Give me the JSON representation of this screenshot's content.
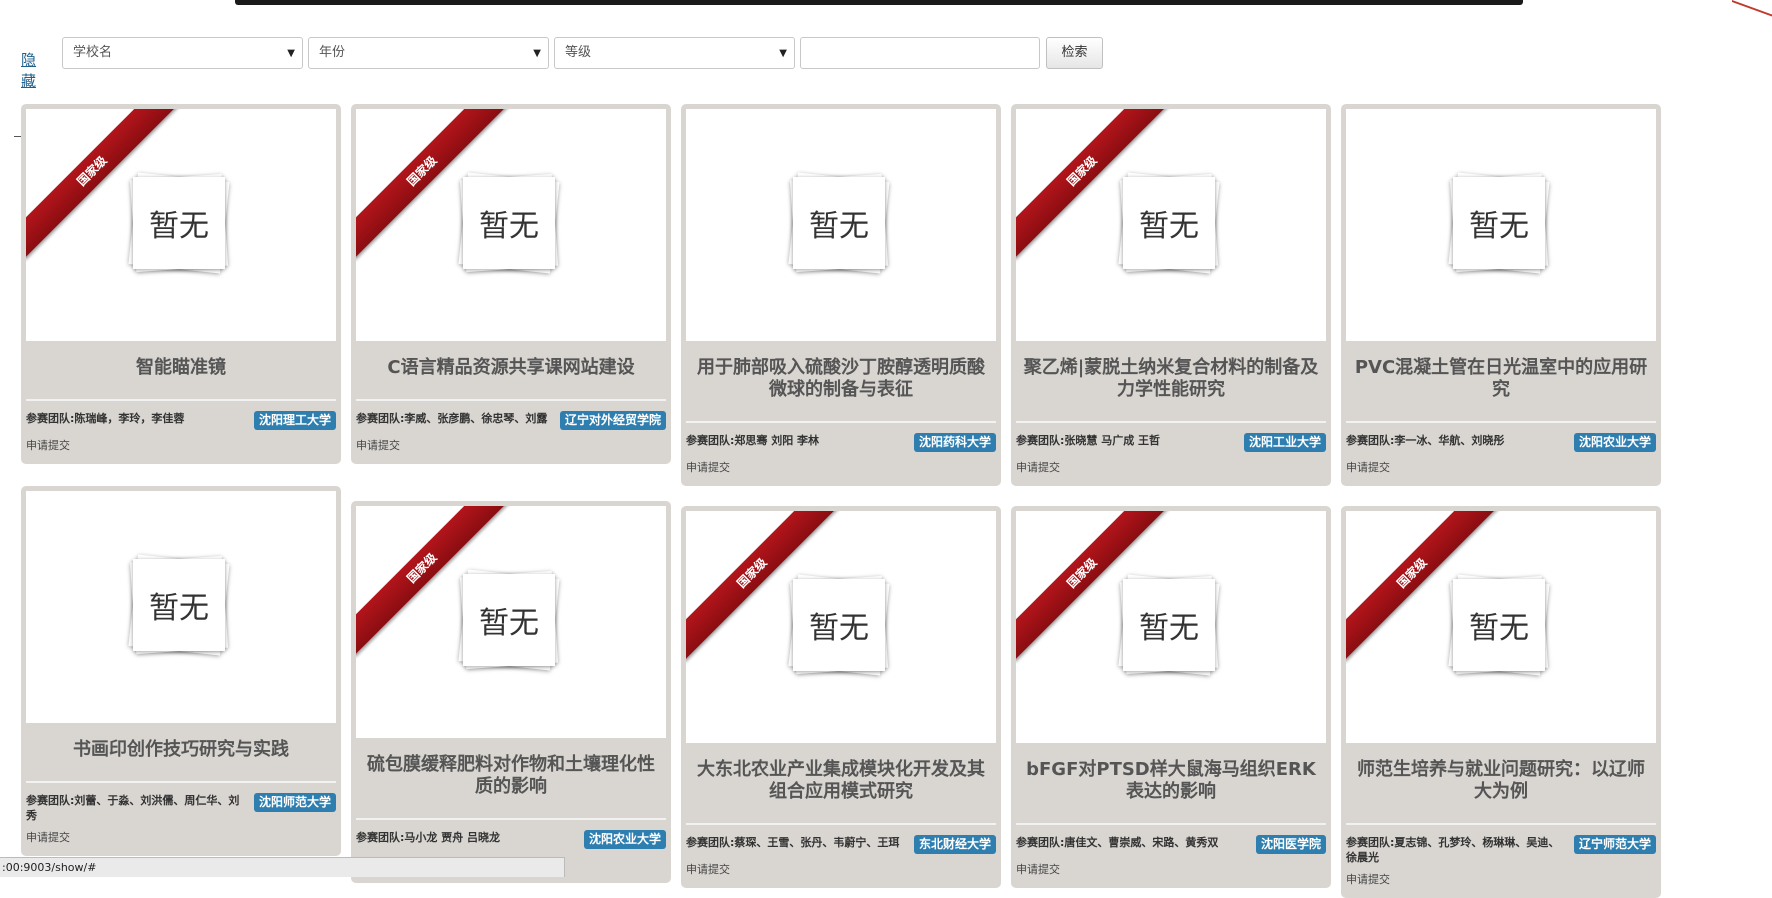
{
  "filters": {
    "hide_link": "隐藏",
    "school_select": "学校名",
    "year_select": "年份",
    "level_select": "等级",
    "search_input_value": "",
    "search_button": "检索"
  },
  "placeholder_text": "暂无",
  "ribbon_text": "国家级",
  "submit_text": "申请提交",
  "cards": [
    {
      "title": "智能瞄准镜",
      "team": "参赛团队:陈瑞峰，李玲，李佳蓉",
      "school": "沈阳理工大学",
      "ribbon": true
    },
    {
      "title": "C语言精品资源共享课网站建设",
      "team": "参赛团队:李威、张彦鹏、徐忠琴、刘露",
      "school": "辽宁对外经贸学院",
      "ribbon": true
    },
    {
      "title": "用于肺部吸入硫酸沙丁胺醇透明质酸微球的制备与表征",
      "team": "参赛团队:郑思骞 刘阳 李林",
      "school": "沈阳药科大学",
      "ribbon": false
    },
    {
      "title": "聚乙烯|蒙脱土纳米复合材料的制备及力学性能研究",
      "team": "参赛团队:张晓慧 马广成 王哲",
      "school": "沈阳工业大学",
      "ribbon": true
    },
    {
      "title": "PVC混凝土管在日光温室中的应用研究",
      "team": "参赛团队:李一冰、华航、刘晓彤",
      "school": "沈阳农业大学",
      "ribbon": false
    },
    {
      "title": "书画印创作技巧研究与实践",
      "team": "参赛团队:刘蕾、于淼、刘洪儒、周仁华、刘秀",
      "school": "沈阳师范大学",
      "ribbon": false
    },
    {
      "title": "硫包膜缓释肥料对作物和土壤理化性质的影响",
      "team": "参赛团队:马小龙 贾舟 吕晓龙",
      "school": "沈阳农业大学",
      "ribbon": true
    },
    {
      "title": "大东北农业产业集成模块化开发及其组合应用模式研究",
      "team": "参赛团队:蔡琛、王雪、张丹、韦蔚宁、王珥",
      "school": "东北财经大学",
      "ribbon": true
    },
    {
      "title": "bFGF对PTSD样大鼠海马组织ERK表达的影响",
      "team": "参赛团队:唐佳文、曹崇威、宋路、黄秀双",
      "school": "沈阳医学院",
      "ribbon": true
    },
    {
      "title": "师范生培养与就业问题研究：以辽师大为例",
      "team": "参赛团队:夏志锦、孔梦玲、杨琳琳、吴迪、徐晨光",
      "school": "辽宁师范大学",
      "ribbon": true
    }
  ],
  "status_url": ":00:9003/show/#"
}
